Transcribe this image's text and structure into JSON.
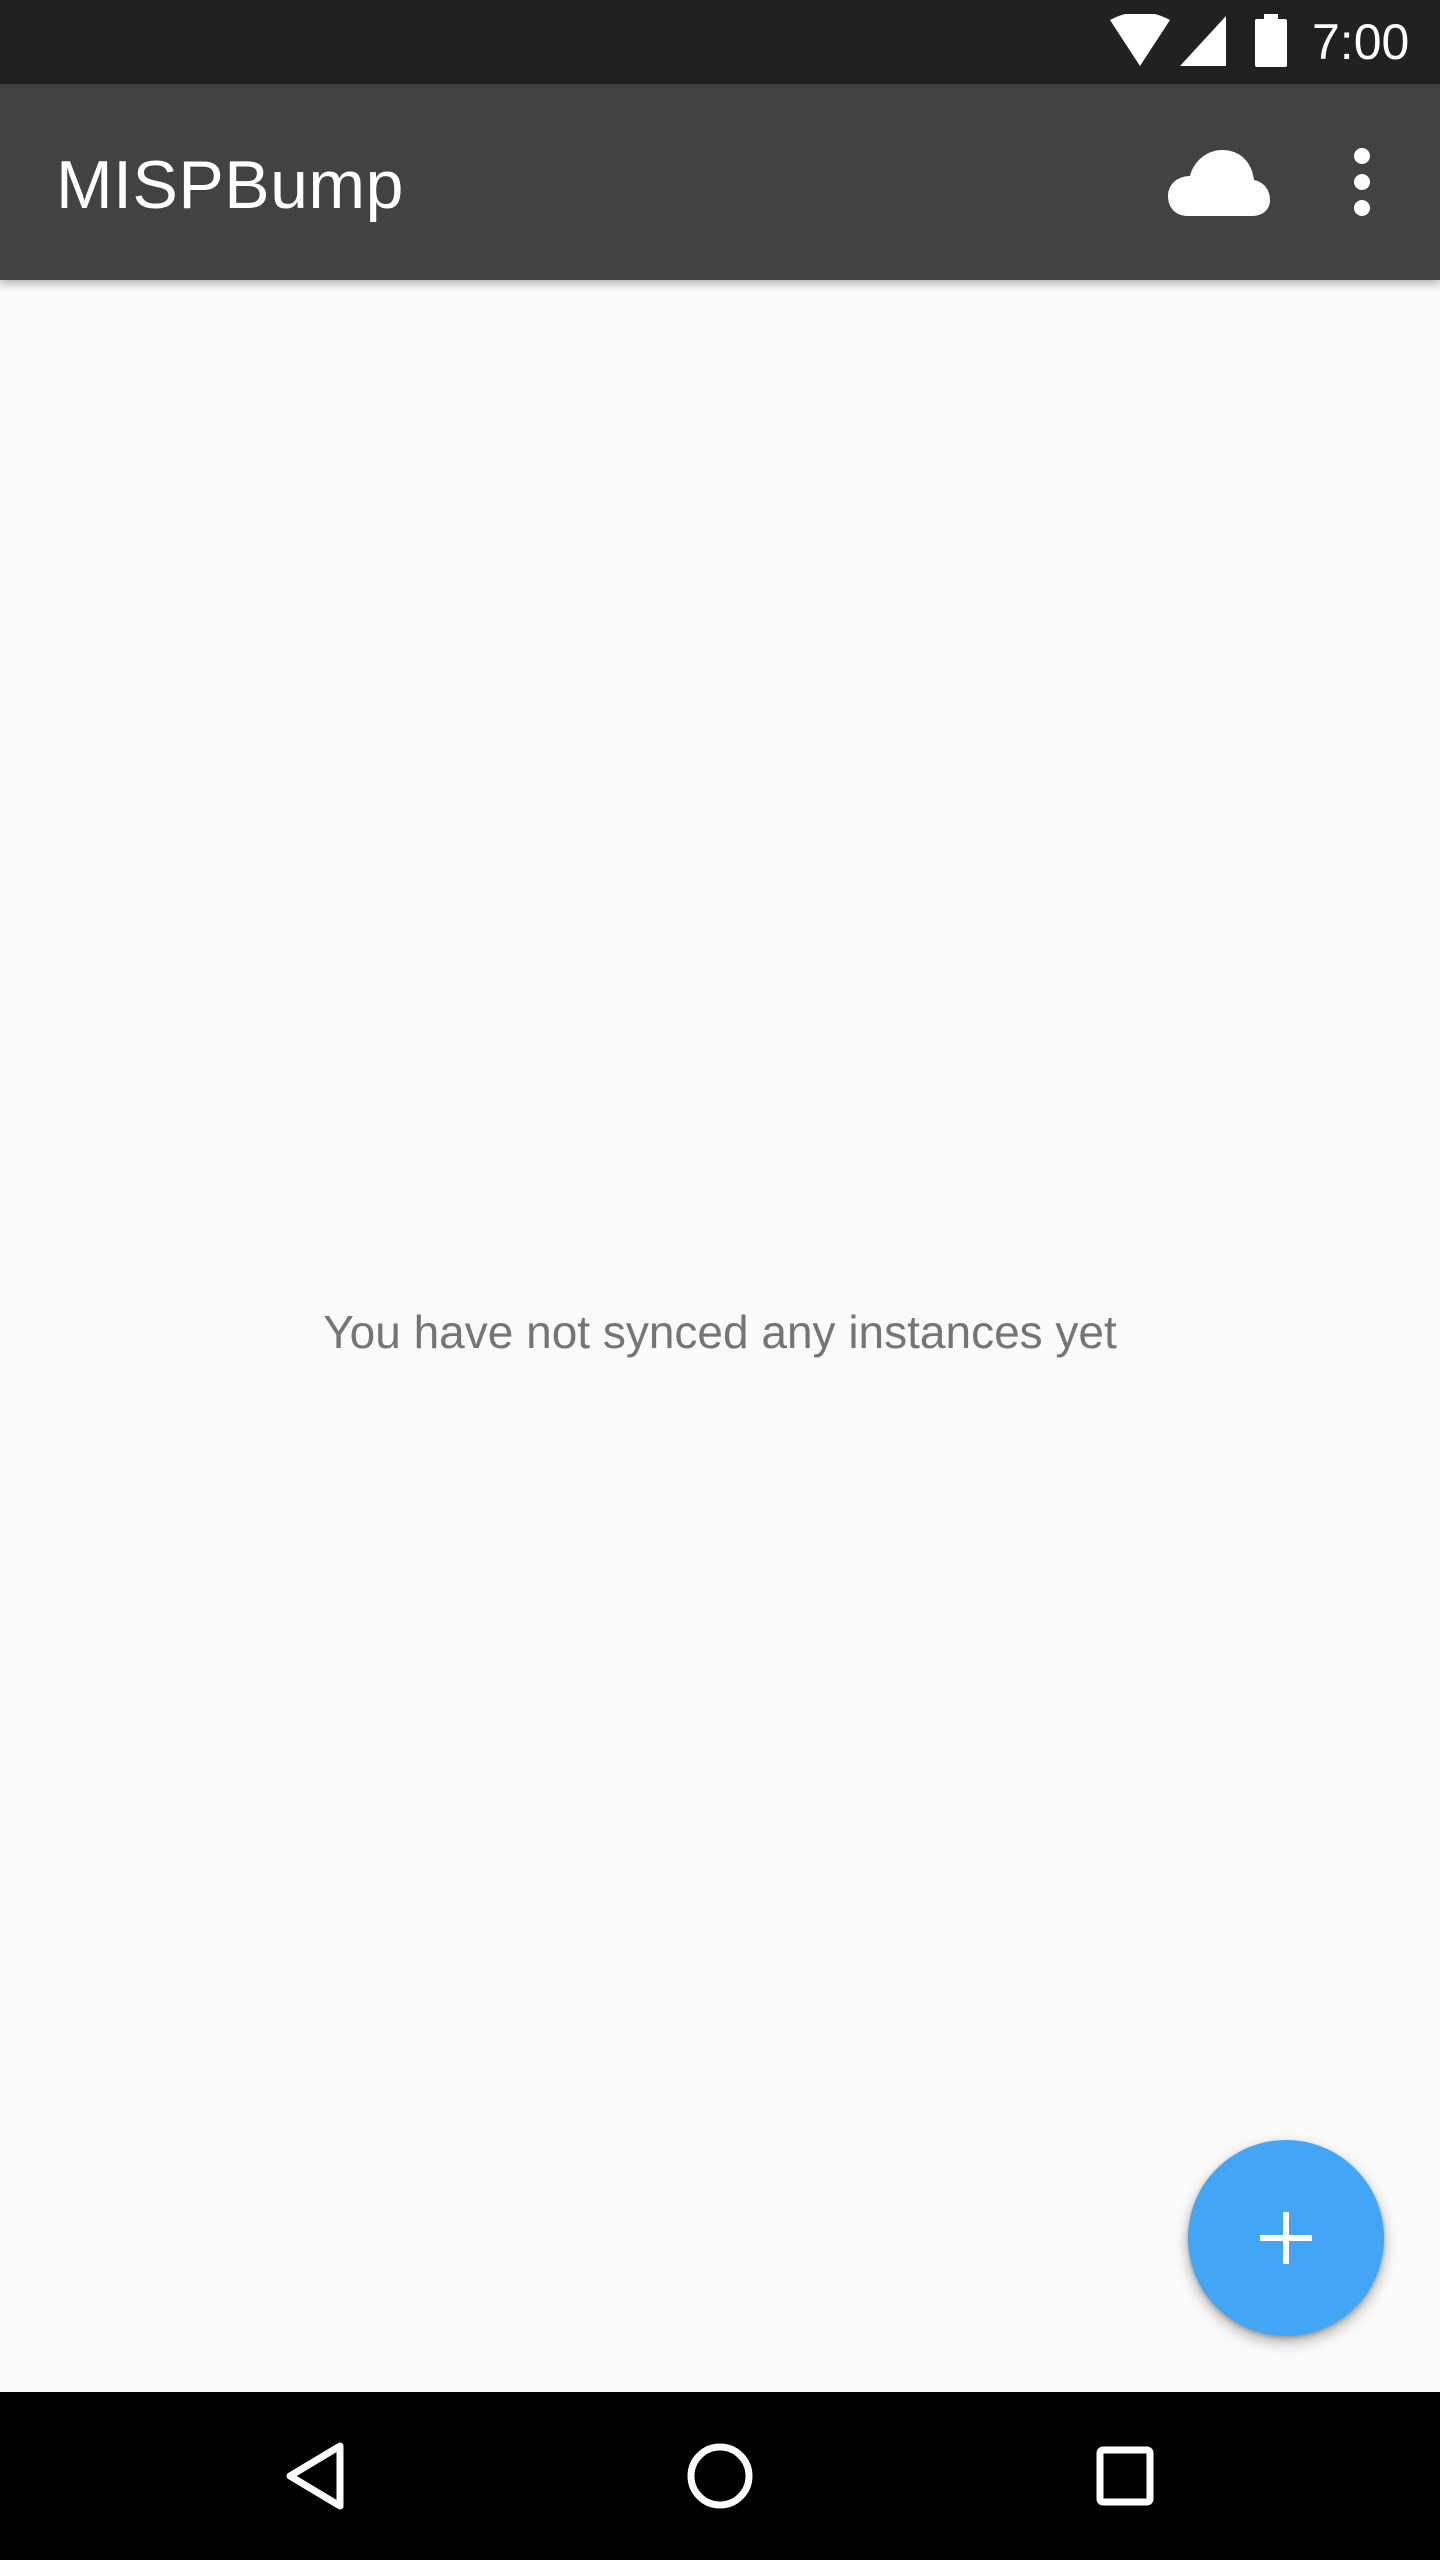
{
  "status_bar": {
    "time": "7:00",
    "icons": [
      "wifi-icon",
      "cell-signal-icon",
      "battery-icon"
    ]
  },
  "app_bar": {
    "title": "MISPBump",
    "actions": [
      "cloud-icon",
      "more-vert-icon"
    ]
  },
  "main": {
    "empty_message": "You have not synced any instances yet"
  },
  "fab": {
    "icon": "plus-icon"
  },
  "nav_bar": {
    "buttons": [
      "back-icon",
      "home-icon",
      "recents-icon"
    ]
  },
  "colors": {
    "status_bar": "#212121",
    "app_bar": "#424242",
    "background": "#fafafa",
    "fab": "#42a5f5",
    "nav_bar": "#000000",
    "empty_text": "#757575"
  }
}
